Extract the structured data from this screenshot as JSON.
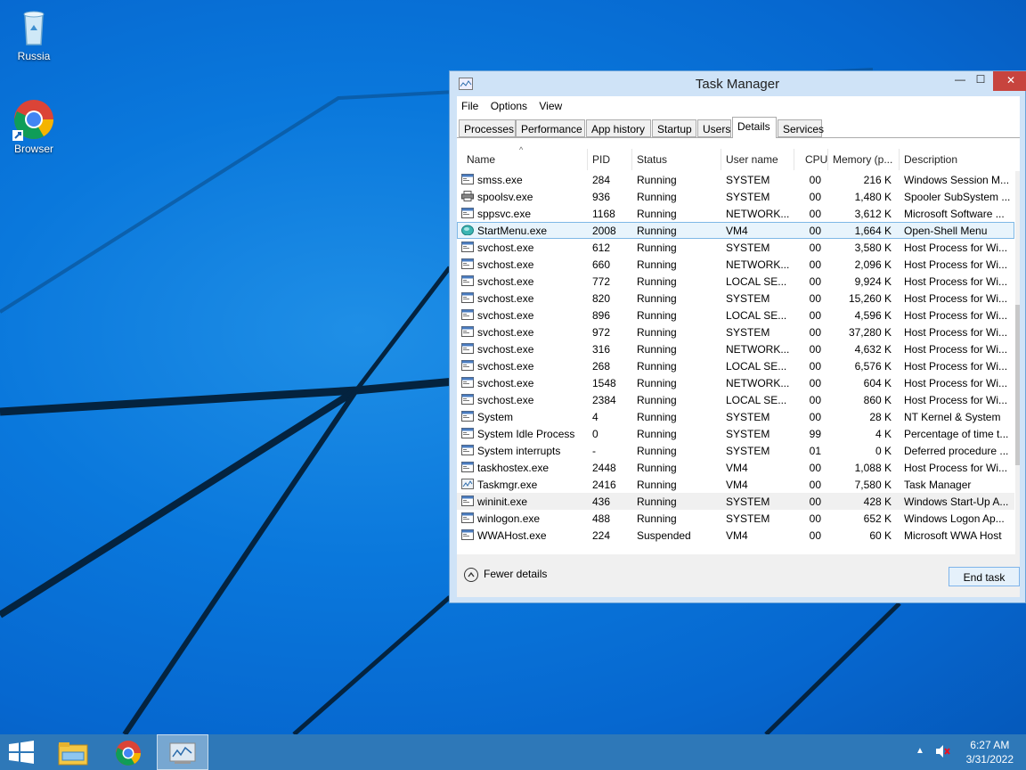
{
  "desktop": {
    "icons": [
      {
        "label": "Russia",
        "icon": "recycle-bin-icon"
      },
      {
        "label": "Browser",
        "icon": "chrome-icon"
      }
    ]
  },
  "window": {
    "title": "Task Manager",
    "controls": {
      "minimize": "—",
      "maximize": "☐",
      "close": "✕"
    },
    "menu": [
      "File",
      "Options",
      "View"
    ],
    "tabs": [
      "Processes",
      "Performance",
      "App history",
      "Startup",
      "Users",
      "Details",
      "Services"
    ],
    "active_tab": "Details",
    "columns": [
      "Name",
      "PID",
      "Status",
      "User name",
      "CPU",
      "Memory (p...",
      "Description"
    ],
    "rows": [
      {
        "name": "smss.exe",
        "pid": "284",
        "status": "Running",
        "user": "SYSTEM",
        "cpu": "00",
        "mem": "216 K",
        "desc": "Windows Session M...",
        "icon": "window-icon"
      },
      {
        "name": "spoolsv.exe",
        "pid": "936",
        "status": "Running",
        "user": "SYSTEM",
        "cpu": "00",
        "mem": "1,480 K",
        "desc": "Spooler SubSystem ...",
        "icon": "printer-icon"
      },
      {
        "name": "sppsvc.exe",
        "pid": "1168",
        "status": "Running",
        "user": "NETWORK...",
        "cpu": "00",
        "mem": "3,612 K",
        "desc": "Microsoft Software ...",
        "icon": "window-icon"
      },
      {
        "name": "StartMenu.exe",
        "pid": "2008",
        "status": "Running",
        "user": "VM4",
        "cpu": "00",
        "mem": "1,664 K",
        "desc": "Open-Shell Menu",
        "icon": "shell-icon"
      },
      {
        "name": "svchost.exe",
        "pid": "612",
        "status": "Running",
        "user": "SYSTEM",
        "cpu": "00",
        "mem": "3,580 K",
        "desc": "Host Process for Wi...",
        "icon": "window-icon"
      },
      {
        "name": "svchost.exe",
        "pid": "660",
        "status": "Running",
        "user": "NETWORK...",
        "cpu": "00",
        "mem": "2,096 K",
        "desc": "Host Process for Wi...",
        "icon": "window-icon"
      },
      {
        "name": "svchost.exe",
        "pid": "772",
        "status": "Running",
        "user": "LOCAL SE...",
        "cpu": "00",
        "mem": "9,924 K",
        "desc": "Host Process for Wi...",
        "icon": "window-icon"
      },
      {
        "name": "svchost.exe",
        "pid": "820",
        "status": "Running",
        "user": "SYSTEM",
        "cpu": "00",
        "mem": "15,260 K",
        "desc": "Host Process for Wi...",
        "icon": "window-icon"
      },
      {
        "name": "svchost.exe",
        "pid": "896",
        "status": "Running",
        "user": "LOCAL SE...",
        "cpu": "00",
        "mem": "4,596 K",
        "desc": "Host Process for Wi...",
        "icon": "window-icon"
      },
      {
        "name": "svchost.exe",
        "pid": "972",
        "status": "Running",
        "user": "SYSTEM",
        "cpu": "00",
        "mem": "37,280 K",
        "desc": "Host Process for Wi...",
        "icon": "window-icon"
      },
      {
        "name": "svchost.exe",
        "pid": "316",
        "status": "Running",
        "user": "NETWORK...",
        "cpu": "00",
        "mem": "4,632 K",
        "desc": "Host Process for Wi...",
        "icon": "window-icon"
      },
      {
        "name": "svchost.exe",
        "pid": "268",
        "status": "Running",
        "user": "LOCAL SE...",
        "cpu": "00",
        "mem": "6,576 K",
        "desc": "Host Process for Wi...",
        "icon": "window-icon"
      },
      {
        "name": "svchost.exe",
        "pid": "1548",
        "status": "Running",
        "user": "NETWORK...",
        "cpu": "00",
        "mem": "604 K",
        "desc": "Host Process for Wi...",
        "icon": "window-icon"
      },
      {
        "name": "svchost.exe",
        "pid": "2384",
        "status": "Running",
        "user": "LOCAL SE...",
        "cpu": "00",
        "mem": "860 K",
        "desc": "Host Process for Wi...",
        "icon": "window-icon"
      },
      {
        "name": "System",
        "pid": "4",
        "status": "Running",
        "user": "SYSTEM",
        "cpu": "00",
        "mem": "28 K",
        "desc": "NT Kernel & System",
        "icon": "window-icon"
      },
      {
        "name": "System Idle Process",
        "pid": "0",
        "status": "Running",
        "user": "SYSTEM",
        "cpu": "99",
        "mem": "4 K",
        "desc": "Percentage of time t...",
        "icon": "window-icon"
      },
      {
        "name": "System interrupts",
        "pid": "-",
        "status": "Running",
        "user": "SYSTEM",
        "cpu": "01",
        "mem": "0 K",
        "desc": "Deferred procedure ...",
        "icon": "window-icon"
      },
      {
        "name": "taskhostex.exe",
        "pid": "2448",
        "status": "Running",
        "user": "VM4",
        "cpu": "00",
        "mem": "1,088 K",
        "desc": "Host Process for Wi...",
        "icon": "window-icon"
      },
      {
        "name": "Taskmgr.exe",
        "pid": "2416",
        "status": "Running",
        "user": "VM4",
        "cpu": "00",
        "mem": "7,580 K",
        "desc": "Task Manager",
        "icon": "taskmgr-icon"
      },
      {
        "name": "wininit.exe",
        "pid": "436",
        "status": "Running",
        "user": "SYSTEM",
        "cpu": "00",
        "mem": "428 K",
        "desc": "Windows Start-Up A...",
        "icon": "window-icon"
      },
      {
        "name": "winlogon.exe",
        "pid": "488",
        "status": "Running",
        "user": "SYSTEM",
        "cpu": "00",
        "mem": "652 K",
        "desc": "Windows Logon Ap...",
        "icon": "window-icon"
      },
      {
        "name": "WWAHost.exe",
        "pid": "224",
        "status": "Suspended",
        "user": "VM4",
        "cpu": "00",
        "mem": "60 K",
        "desc": "Microsoft WWA Host",
        "icon": "window-icon"
      }
    ],
    "selected_row": 3,
    "hover_row": 19,
    "fewer_details": "Fewer details",
    "end_task": "End task"
  },
  "taskbar": {
    "items": [
      "start-icon",
      "file-explorer-icon",
      "chrome-icon",
      "task-manager-icon"
    ],
    "time": "6:27 AM",
    "date": "3/31/2022"
  }
}
